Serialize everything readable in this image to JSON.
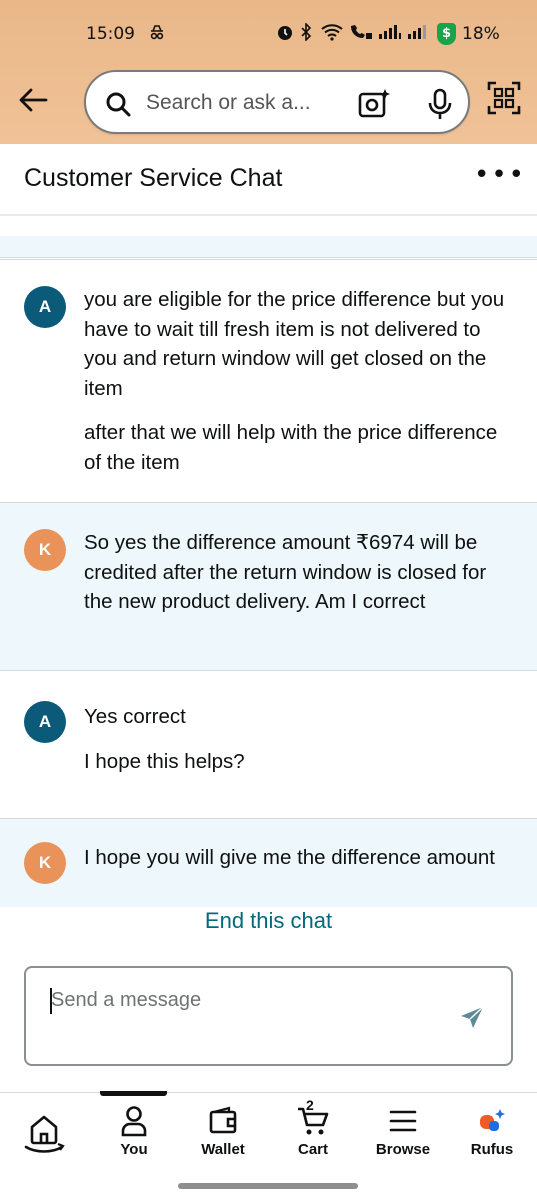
{
  "status_bar": {
    "time": "15:09",
    "battery": "18%"
  },
  "header": {
    "search_placeholder": "Search or ask a..."
  },
  "chat": {
    "title": "Customer Service Chat",
    "messages": [
      {
        "sender": "agent",
        "initial": "A",
        "paragraphs": [
          "you are eligible for the price difference but you have to wait till fresh item is not delivered to you and return window will get closed on the item",
          "after that we will help with the price difference of the item"
        ]
      },
      {
        "sender": "customer",
        "initial": "K",
        "paragraphs": [
          "So yes the difference amount ₹6974 will be credited after the return window is closed for the new product delivery. Am I correct"
        ]
      },
      {
        "sender": "agent",
        "initial": "A",
        "paragraphs": [
          "Yes correct",
          "I hope this helps?"
        ]
      },
      {
        "sender": "customer",
        "initial": "K",
        "paragraphs": [
          "I hope you will give me the difference amount"
        ]
      }
    ],
    "end_chat_label": "End this chat",
    "composer_placeholder": "Send a message"
  },
  "bottom_nav": {
    "items": [
      {
        "label": "",
        "icon": "home-icon"
      },
      {
        "label": "You",
        "icon": "person-icon"
      },
      {
        "label": "Wallet",
        "icon": "wallet-icon"
      },
      {
        "label": "Cart",
        "icon": "cart-icon",
        "count": "2"
      },
      {
        "label": "Browse",
        "icon": "menu-icon"
      },
      {
        "label": "Rufus",
        "icon": "rufus-icon"
      }
    ]
  },
  "colors": {
    "header_bg": "#f0c297",
    "agent_avatar": "#0b5a7a",
    "customer_avatar": "#e9925a",
    "customer_bubble_bg": "#eef7fb",
    "link": "#006a7a",
    "shield": "#1aa34a"
  }
}
